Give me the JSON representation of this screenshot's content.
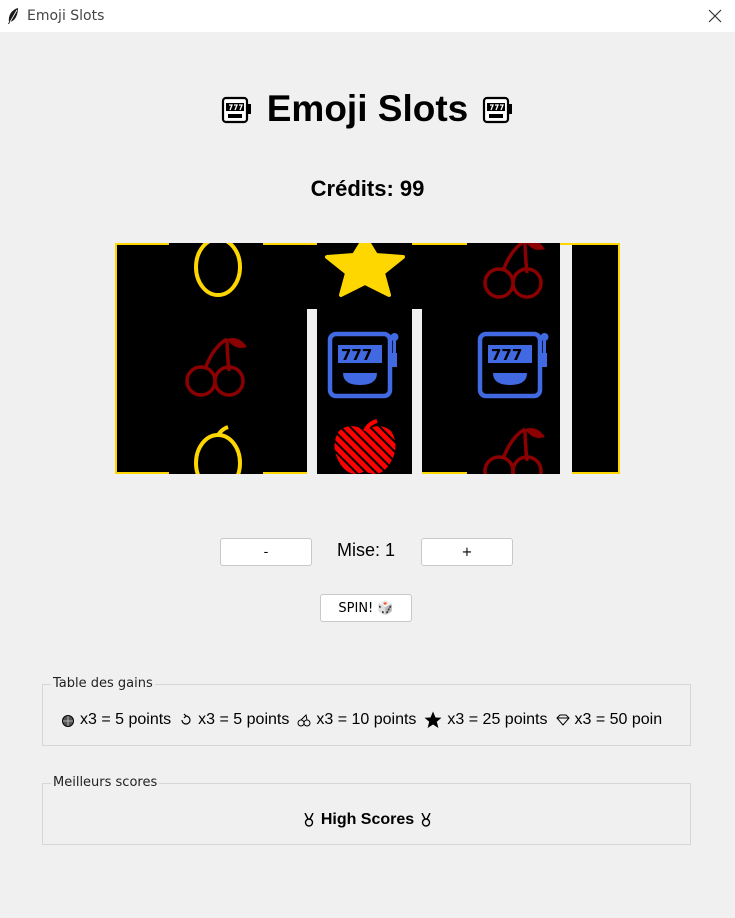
{
  "window": {
    "title": "Emoji Slots",
    "icons": {
      "app": "feather-icon",
      "close": "close-icon"
    }
  },
  "header": {
    "title": "Emoji Slots",
    "icon": "slot-machine-icon"
  },
  "credits": {
    "label": "Crédits: 99"
  },
  "reels": [
    {
      "symbols": [
        "lemon",
        "cherries",
        "lemon"
      ]
    },
    {
      "symbols": [
        "star",
        "slot-machine",
        "apple"
      ]
    },
    {
      "symbols": [
        "cherries",
        "slot-machine",
        "cherries"
      ]
    }
  ],
  "colors": {
    "frame": "#ffd700",
    "lemon": "#ffd700",
    "cherry": "#8b0000",
    "star": "#ffd700",
    "slot": "#4169e1",
    "apple": "#ff0000"
  },
  "controls": {
    "minus_label": "-",
    "bet_label": "Mise: 1",
    "plus_label": "+",
    "spin_label": "SPIN! 🎲"
  },
  "paytable": {
    "label": "Table des gains",
    "items": [
      {
        "icon": "ball-icon",
        "text": "x3 = 5 points"
      },
      {
        "icon": "cycle-icon",
        "text": "x3 = 5 points"
      },
      {
        "icon": "cherries-icon",
        "text": "x3 = 10 points"
      },
      {
        "icon": "star-icon",
        "text": "x3 = 25 points"
      },
      {
        "icon": "gem-icon",
        "text": "x3 = 50 poin"
      }
    ]
  },
  "scores": {
    "label": "Meilleurs scores",
    "title": "High Scores",
    "icon": "medal-icon"
  }
}
